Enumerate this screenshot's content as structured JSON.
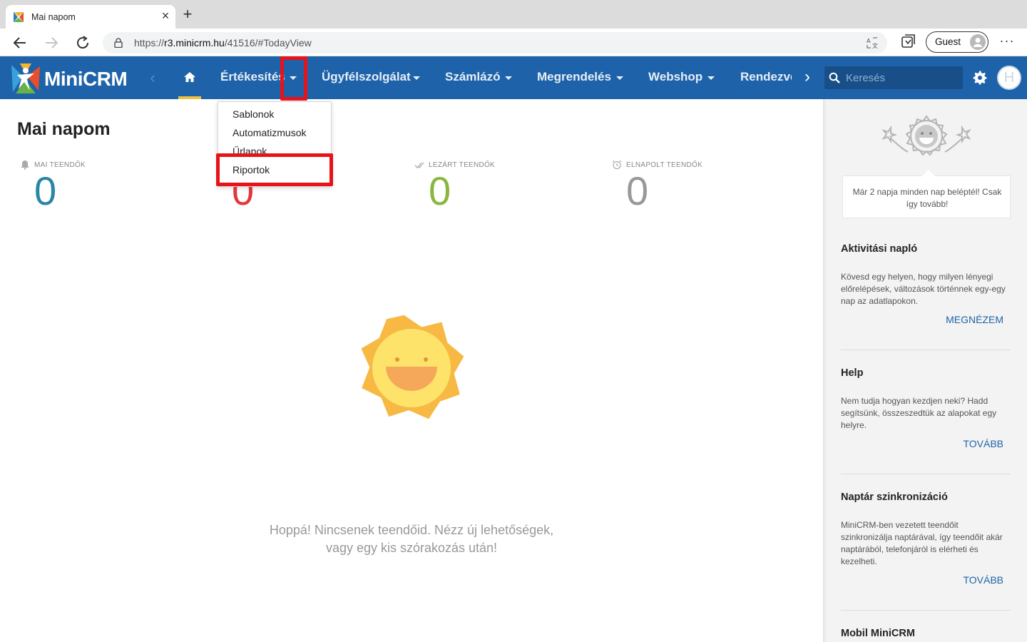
{
  "browser": {
    "tab_title": "Mai napom",
    "url_prefix": "https://",
    "url_host": "r3.minicrm.hu",
    "url_path": "/41516/#TodayView",
    "profile_label": "Guest"
  },
  "app": {
    "logo_text": "MiniCRM",
    "nav": {
      "items": [
        {
          "label": "Értékesítés"
        },
        {
          "label": "Ügyfélszolgálat"
        },
        {
          "label": "Számlázó"
        },
        {
          "label": "Megrendelés"
        },
        {
          "label": "Webshop"
        },
        {
          "label": "Rendezvé"
        }
      ],
      "search_placeholder": "Keresés",
      "avatar_letter": "H"
    },
    "dropdown": {
      "items": [
        "Sablonok",
        "Automatizmusok",
        "Űrlapok",
        "Riportok"
      ]
    }
  },
  "main": {
    "title": "Mai napom",
    "stats": [
      {
        "label": "MAI TEENDŐK",
        "value": "0",
        "color": "#2a86a6",
        "icon": "bell-icon"
      },
      {
        "label": "",
        "value": "0",
        "color": "#e2383c",
        "icon": ""
      },
      {
        "label": "LEZÁRT TEENDŐK",
        "value": "0",
        "color": "#8ab63f",
        "icon": "double-check-icon"
      },
      {
        "label": "ELNAPOLT TEENDŐK",
        "value": "0",
        "color": "#999999",
        "icon": "alarm-clock-icon"
      }
    ],
    "empty_message_line1": "Hoppá! Nincsenek teendőid. Nézz új lehetőségek,",
    "empty_message_line2": "vagy egy kis szórakozás után!"
  },
  "sidebar": {
    "streak_text": "Már 2 napja minden nap beléptél! Csak így tovább!",
    "sections": [
      {
        "title": "Aktivitási napló",
        "text": "Kövesd egy helyen, hogy milyen lényegi előrelépések, változások történnek egy-egy nap az adatlapokon.",
        "link": "MEGNÉZEM"
      },
      {
        "title": "Help",
        "text": "Nem tudja hogyan kezdjen neki? Hadd segítsünk, összeszedtük az alapokat egy helyre.",
        "link": "TOVÁBB"
      },
      {
        "title": "Naptár szinkronizáció",
        "text": "MiniCRM-ben vezetett teendőit szinkronizálja naptárával, így teendőit akár naptárából, telefonjáról is elérheti és kezelheti.",
        "link": "TOVÁBB"
      },
      {
        "title": "Mobil MiniCRM"
      }
    ]
  },
  "colors": {
    "nav_bg": "#1e63a9",
    "home_underline": "#f0c040",
    "highlight": "#e8121a",
    "link": "#1e63a9"
  }
}
